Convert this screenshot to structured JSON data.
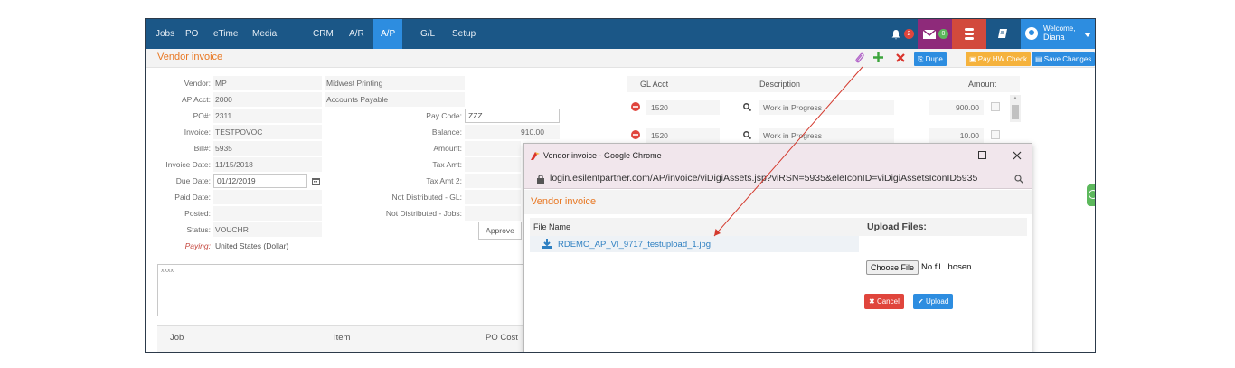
{
  "nav": {
    "items": [
      "Jobs",
      "PO",
      "eTime",
      "Media",
      "CRM",
      "A/R",
      "A/P",
      "G/L",
      "Setup"
    ],
    "active": "A/P",
    "alerts_count": "2",
    "messages_count": "0",
    "welcome_label": "Welcome,",
    "welcome_name": "Diana"
  },
  "title": "Vendor invoice",
  "toolbar": {
    "dupe": "Dupe",
    "pay_hw_check": "Pay HW Check",
    "save_changes": "Save Changes"
  },
  "form": {
    "vendor_label": "Vendor:",
    "vendor_code": "MP",
    "vendor_name": "Midwest Printing",
    "ap_acct_label": "AP Acct:",
    "ap_acct_code": "2000",
    "ap_acct_name": "Accounts Payable",
    "po_label": "PO#:",
    "po_value": "2311",
    "pay_code_label": "Pay Code:",
    "pay_code_value": "ZZZ",
    "invoice_label": "Invoice:",
    "invoice_value": "TESTPOVOC",
    "balance_label": "Balance:",
    "balance_value": "910.00",
    "bill_label": "Bill#:",
    "bill_value": "5935",
    "amount_label": "Amount:",
    "invoice_date_label": "Invoice Date:",
    "invoice_date_value": "11/15/2018",
    "tax_amt_label": "Tax Amt:",
    "due_date_label": "Due Date:",
    "due_date_value": "01/12/2019",
    "tax_amt2_label": "Tax Amt 2:",
    "paid_date_label": "Paid Date:",
    "not_dist_gl_label": "Not Distributed - GL:",
    "posted_label": "Posted:",
    "not_dist_jobs_label": "Not Distributed - Jobs:",
    "status_label": "Status:",
    "status_value": "VOUCHR",
    "approve_label": "Approve",
    "paying_label": "Paying:",
    "paying_value": "United States (Dollar)",
    "notes_value": "xxxx"
  },
  "job_table": {
    "headers": [
      "Job",
      "Item",
      "PO Cost"
    ]
  },
  "gl_table": {
    "headers": [
      "GL Acct",
      "Description",
      "Amount"
    ],
    "rows": [
      {
        "acct": "1520",
        "description": "Work in Progress",
        "amount": "900.00"
      },
      {
        "acct": "1520",
        "description": "Work in Progress",
        "amount": "10.00"
      }
    ]
  },
  "popup": {
    "window_title": "Vendor invoice - Google Chrome",
    "url": "login.esilentpartner.com/AP/invoice/viDigiAssets.jsp?viRSN=5935&eleIconID=viDigiAssetsIconID5935",
    "heading": "Vendor invoice",
    "file_name_header": "File Name",
    "upload_header": "Upload Files:",
    "file_name": "RDEMO_AP_VI_9717_testupload_1.jpg",
    "choose_file": "Choose File",
    "no_file": "No fil...hosen",
    "cancel": "Cancel",
    "upload": "Upload"
  },
  "colors": {
    "nav_bg": "#1b5787",
    "nav_active": "#2d8de0",
    "title_orange": "#e87722",
    "cancel_red": "#e0453c",
    "link_blue": "#2d7fc1"
  }
}
